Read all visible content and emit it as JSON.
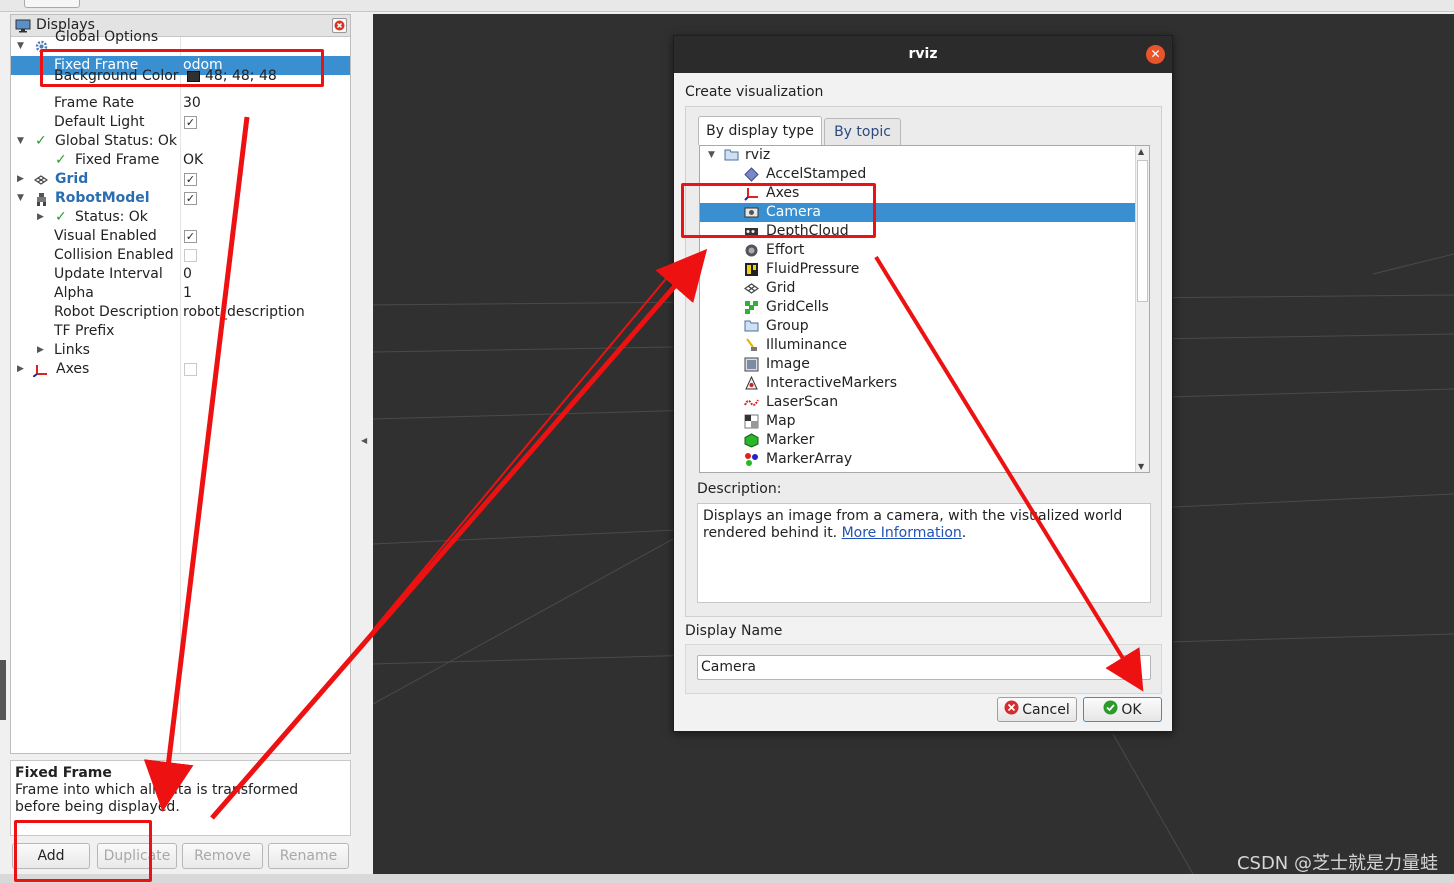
{
  "displays_panel": {
    "title": "Displays",
    "rows": [
      {
        "label": "Global Options",
        "value": ""
      },
      {
        "label": "Fixed Frame",
        "value": "odom"
      },
      {
        "label": "Background Color",
        "value": "48; 48; 48"
      },
      {
        "label": "Frame Rate",
        "value": "30"
      },
      {
        "label": "Default Light",
        "value": ""
      },
      {
        "label": "Global Status: Ok",
        "value": ""
      },
      {
        "label": "Fixed Frame",
        "value": "OK"
      },
      {
        "label": "Grid",
        "value": ""
      },
      {
        "label": "RobotModel",
        "value": ""
      },
      {
        "label": "Status: Ok",
        "value": ""
      },
      {
        "label": "Visual Enabled",
        "value": ""
      },
      {
        "label": "Collision Enabled",
        "value": ""
      },
      {
        "label": "Update Interval",
        "value": "0"
      },
      {
        "label": "Alpha",
        "value": "1"
      },
      {
        "label": "Robot Description",
        "value": "robot_description"
      },
      {
        "label": "TF Prefix",
        "value": ""
      },
      {
        "label": "Links",
        "value": ""
      },
      {
        "label": "Axes",
        "value": ""
      }
    ]
  },
  "property_description": {
    "title": "Fixed Frame",
    "text": "Frame into which all data is transformed before being displayed."
  },
  "bottom_buttons": {
    "add": "Add",
    "duplicate": "Duplicate",
    "remove": "Remove",
    "rename": "Rename"
  },
  "dialog": {
    "title": "rviz",
    "create_label": "Create visualization",
    "tabs": [
      "By display type",
      "By topic"
    ],
    "root": "rviz",
    "items": [
      "AccelStamped",
      "Axes",
      "Camera",
      "DepthCloud",
      "Effort",
      "FluidPressure",
      "Grid",
      "GridCells",
      "Group",
      "Illuminance",
      "Image",
      "InteractiveMarkers",
      "LaserScan",
      "Map",
      "Marker",
      "MarkerArray"
    ],
    "selected_item": "Camera",
    "description_label": "Description:",
    "description_text": "Displays an image from a camera, with the visualized world rendered behind it.",
    "more_info_link": "More Information",
    "display_name_label": "Display Name",
    "display_name_value": "Camera",
    "cancel_label": "Cancel",
    "ok_label": "OK"
  },
  "watermark": "CSDN @芝士就是力量蛙",
  "colors": {
    "selection": "#3a8fd0",
    "annotation": "#ee1111",
    "view_background": "#303030"
  }
}
